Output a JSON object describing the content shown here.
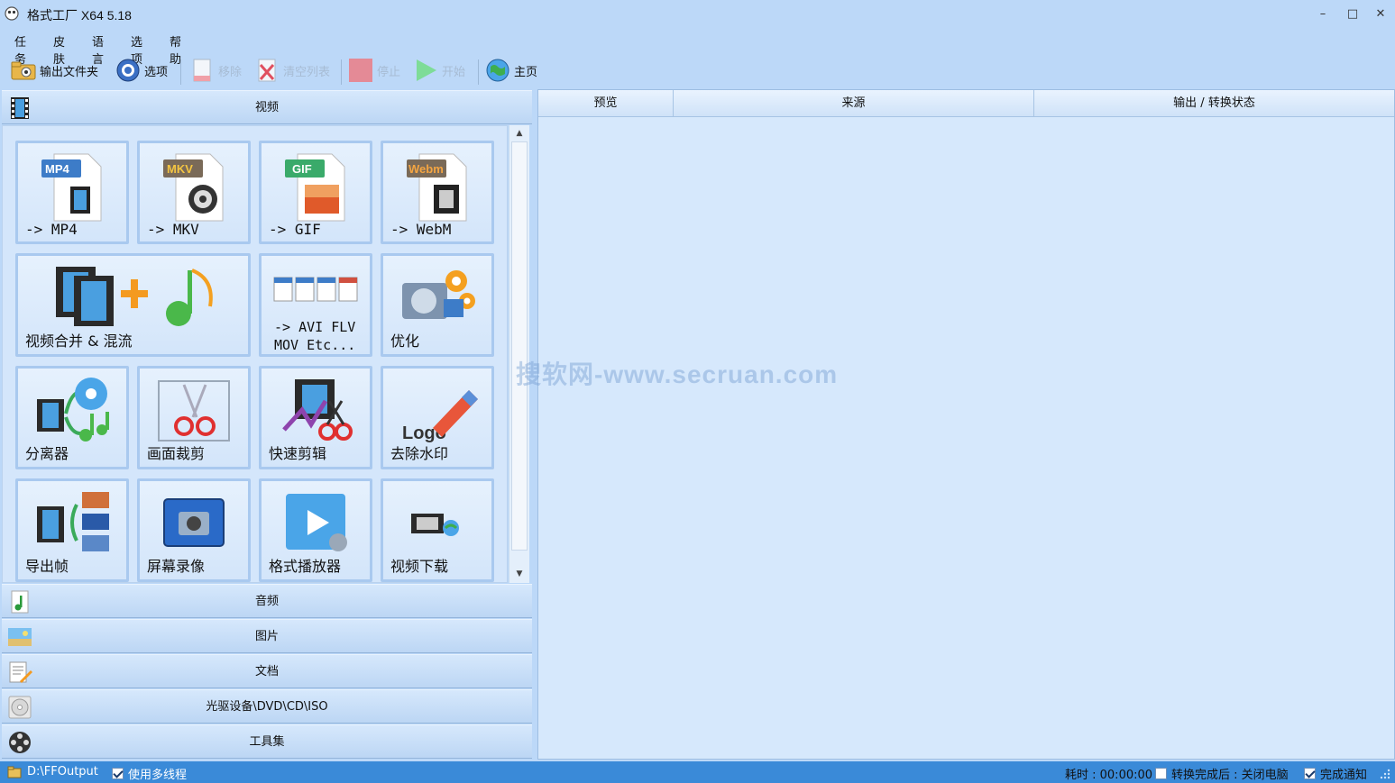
{
  "window": {
    "title": "格式工厂 X64 5.18",
    "controls": [
      "–",
      "□",
      "✕"
    ]
  },
  "menu": [
    "任务",
    "皮肤",
    "语言",
    "选项",
    "帮助"
  ],
  "toolbar": {
    "output_folder": "输出文件夹",
    "options": "选项",
    "remove": "移除",
    "clear_list": "清空列表",
    "stop": "停止",
    "start": "开始",
    "home": "主页"
  },
  "categories": {
    "video": "视频",
    "audio": "音频",
    "image": "图片",
    "document": "文档",
    "optical": "光驱设备\\DVD\\CD\\ISO",
    "tools": "工具集"
  },
  "video_tiles": {
    "mp4": {
      "badge": "MP4",
      "label": "-> MP4"
    },
    "mkv": {
      "badge": "MKV",
      "label": "-> MKV"
    },
    "gif": {
      "badge": "GIF",
      "label": "-> GIF"
    },
    "webm": {
      "badge": "Webm",
      "label": "-> WebM"
    },
    "merge": {
      "label": "视频合并 & 混流"
    },
    "multi": {
      "line1": "-> AVI FLV",
      "line2": "MOV Etc..."
    },
    "optimize": {
      "label": "优化"
    },
    "splitter": {
      "label": "分离器"
    },
    "crop": {
      "label": "画面裁剪"
    },
    "quick_cut": {
      "label": "快速剪辑"
    },
    "remove_logo": {
      "label": "去除水印",
      "art_text": "Logo"
    },
    "export_frames": {
      "label": "导出帧"
    },
    "screen_record": {
      "label": "屏幕录像"
    },
    "player": {
      "label": "格式播放器"
    },
    "downloader": {
      "label": "视频下载"
    }
  },
  "table": {
    "columns": [
      "预览",
      "来源",
      "输出 / 转换状态"
    ]
  },
  "watermark": "搜软网-www.secruan.com",
  "status": {
    "output_path": "D:\\FFOutput",
    "multithread": "使用多线程",
    "multithread_checked": true,
    "elapsed": "耗时 : 00:00:00",
    "after_done": "转换完成后 : 关闭电脑",
    "after_done_checked": false,
    "notify": "完成通知",
    "notify_checked": true
  },
  "colors": {
    "background": "#bcd8f8",
    "status_bar": "#3a8ad8",
    "tile_border": "#a9c9ef"
  }
}
